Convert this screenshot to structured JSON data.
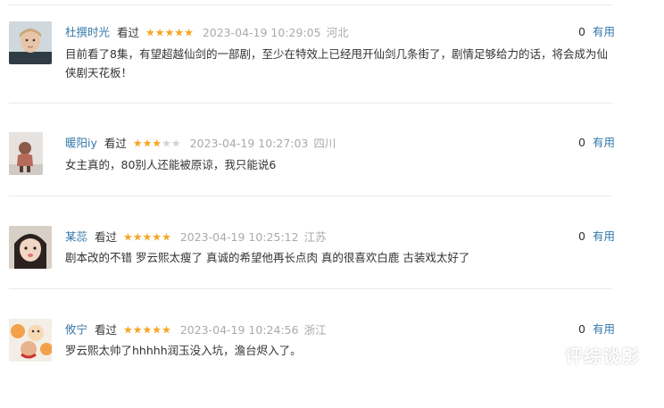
{
  "reviews": [
    {
      "user": "杜撰时光",
      "action": "看过",
      "rating": 5,
      "time": "2023-04-19 10:29:05",
      "region": "河北",
      "useful_count": "0",
      "useful_label": "有用",
      "content": "目前看了8集，有望超越仙剑的一部剧，至少在特效上已经甩开仙剑几条街了，剧情足够给力的话，将会成为仙侠剧天花板！"
    },
    {
      "user": "暖阳iy",
      "action": "看过",
      "rating": 3,
      "time": "2023-04-19 10:27:03",
      "region": "四川",
      "useful_count": "0",
      "useful_label": "有用",
      "content": "女主真的，80别人还能被原谅，我只能说6"
    },
    {
      "user": "某蕊",
      "action": "看过",
      "rating": 5,
      "time": "2023-04-19 10:25:12",
      "region": "江苏",
      "useful_count": "0",
      "useful_label": "有用",
      "content": "剧本改的不错 罗云熙太瘦了 真诚的希望他再长点肉 真的很喜欢白鹿 古装戏太好了"
    },
    {
      "user": "攸宁",
      "action": "看过",
      "rating": 5,
      "time": "2023-04-19 10:24:56",
      "region": "浙江",
      "useful_count": "0",
      "useful_label": "有用",
      "content": "罗云熙太帅了hhhhh润玉没入坑，澹台烬入了。"
    }
  ],
  "watermark": "评综谈影",
  "colors": {
    "link": "#3377aa",
    "star": "#f5a623",
    "star_empty": "#d3d3d3",
    "muted": "#aaaaaa"
  }
}
